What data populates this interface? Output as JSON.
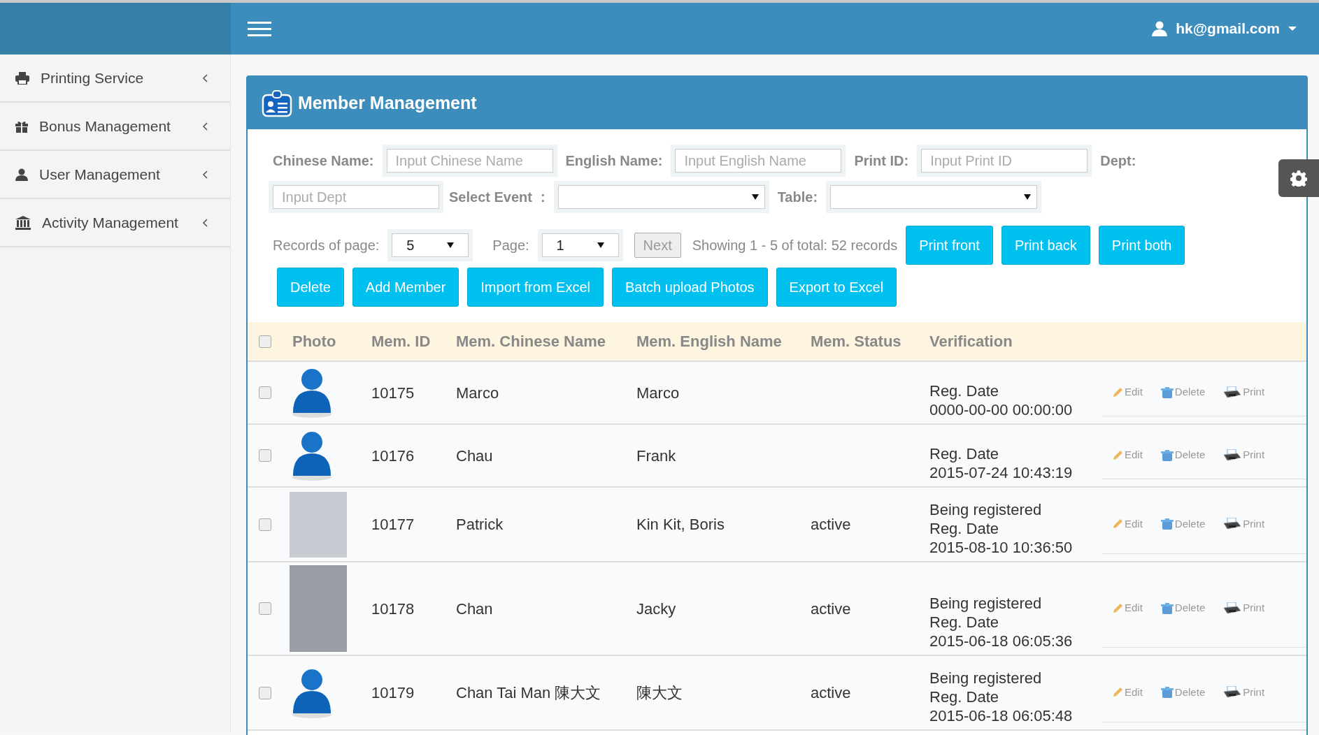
{
  "topbar": {
    "user": "hk@gmail.com"
  },
  "sidebar": {
    "items": [
      {
        "kind": "printer",
        "label": "Printing Service",
        "expanded": false
      },
      {
        "kind": "gift",
        "label": "Bonus Management",
        "expanded": false
      },
      {
        "kind": "user",
        "label": "User Management",
        "expanded": false
      },
      {
        "kind": "bank",
        "label": "Activity Management",
        "expanded": false
      }
    ]
  },
  "panel": {
    "title": "Member Management"
  },
  "filters": [
    {
      "kind": "input",
      "label": "Chinese Name:",
      "placeholder": "Input Chinese Name"
    },
    {
      "kind": "input",
      "label": "English Name:",
      "placeholder": "Input English Name"
    },
    {
      "kind": "input",
      "label": "Print ID:",
      "placeholder": "Input Print ID"
    },
    {
      "kind": "input",
      "label": "Dept:",
      "placeholder": "Input Dept"
    },
    {
      "kind": "select",
      "label": "Select Event",
      "separator": ":"
    },
    {
      "kind": "select",
      "label": "Table:"
    }
  ],
  "paging": {
    "records_label": "Records of page:",
    "records_value": "5",
    "page_label": "Page:",
    "page_value": "1",
    "next": "Next",
    "summary": "Showing 1 - 5 of total: 52 records"
  },
  "print_buttons": [
    "Print front",
    "Print back",
    "Print both"
  ],
  "action_buttons": [
    "Delete",
    "Add Member",
    "Import from Excel",
    "Batch upload Photos",
    "Export to Excel"
  ],
  "table": {
    "select_all_checked": false,
    "columns": [
      "Photo",
      "Mem. ID",
      "Mem. Chinese Name",
      "Mem. English Name",
      "Mem. Status",
      "Verification"
    ],
    "rows": [
      {
        "checked": false,
        "photo": {
          "kind": "avatar"
        },
        "id": "10175",
        "chinese_name": "Marco",
        "english_name": "Marco",
        "verification": [
          "Reg. Date",
          "0000-00-00 00:00:00"
        ],
        "actions": [
          {
            "kind": "edit",
            "label": "Edit"
          },
          {
            "kind": "delete",
            "label": "Delete"
          },
          {
            "kind": "print",
            "label": "Print"
          }
        ]
      },
      {
        "checked": false,
        "photo": {
          "kind": "avatar"
        },
        "id": "10176",
        "chinese_name": "Chau",
        "english_name": "Frank",
        "verification": [
          "Reg. Date",
          "2015-07-24 10:43:19"
        ],
        "actions": [
          {
            "kind": "edit",
            "label": "Edit"
          },
          {
            "kind": "delete",
            "label": "Delete"
          },
          {
            "kind": "print",
            "label": "Print"
          }
        ]
      },
      {
        "checked": false,
        "photo": {
          "kind": "photo"
        },
        "id": "10177",
        "chinese_name": "Patrick",
        "english_name": "Kin Kit, Boris",
        "status": "active",
        "verification": [
          "Being registered",
          "Reg. Date",
          "2015-08-10 10:36:50"
        ],
        "actions": [
          {
            "kind": "edit",
            "label": "Edit"
          },
          {
            "kind": "delete",
            "label": "Delete"
          },
          {
            "kind": "print",
            "label": "Print"
          }
        ]
      },
      {
        "checked": false,
        "photo": {
          "kind": "tall"
        },
        "id": "10178",
        "chinese_name": "Chan",
        "english_name": "Jacky",
        "status": "active",
        "verification": [
          "Being registered",
          "Reg. Date",
          "2015-06-18 06:05:36"
        ],
        "actions": [
          {
            "kind": "edit",
            "label": "Edit"
          },
          {
            "kind": "delete",
            "label": "Delete"
          },
          {
            "kind": "print",
            "label": "Print"
          }
        ]
      },
      {
        "checked": false,
        "photo": {
          "kind": "avatar"
        },
        "id": "10179",
        "chinese_name": "Chan Tai Man 陳大文",
        "english_name": "陳大文",
        "status": "active",
        "verification": [
          "Being registered",
          "Reg. Date",
          "2015-06-18 06:05:48"
        ],
        "actions": [
          {
            "kind": "edit",
            "label": "Edit"
          },
          {
            "kind": "delete",
            "label": "Delete"
          },
          {
            "kind": "print",
            "label": "Print"
          }
        ]
      }
    ]
  }
}
